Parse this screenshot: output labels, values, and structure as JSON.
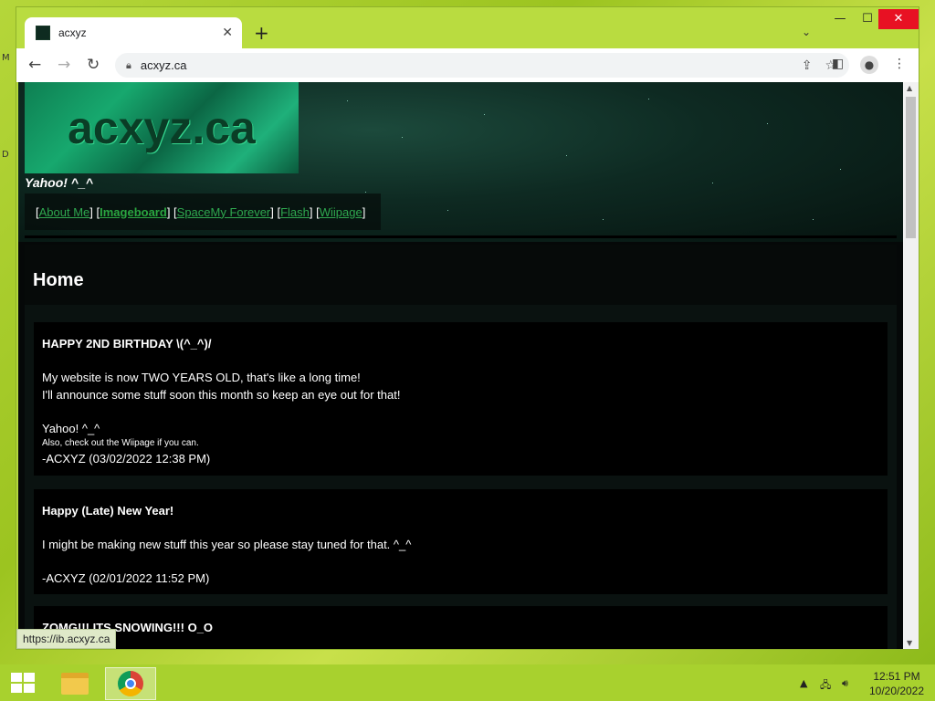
{
  "desktop": {
    "edge_glyphs": [
      "M",
      "D"
    ]
  },
  "browser": {
    "tab": {
      "title": "acxyz",
      "close": "✕"
    },
    "new_tab": "+",
    "tab_list": "⌄",
    "window_controls": {
      "minimize": "—",
      "maximize": "☐",
      "close": "✕"
    },
    "toolbar": {
      "back": "←",
      "forward": "→",
      "reload": "↻",
      "url": "acxyz.ca",
      "side_panel": "◧",
      "menu": "⋮"
    },
    "status_url": "https://ib.acxyz.ca"
  },
  "site": {
    "logo": "acxyz.ca",
    "tagline": "Yahoo! ^_^",
    "nav": [
      {
        "label": "About Me",
        "bold": false
      },
      {
        "label": "Imageboard",
        "bold": true
      },
      {
        "label": "SpaceMy Forever",
        "bold": false
      },
      {
        "label": "Flash",
        "bold": false
      },
      {
        "label": "Wiipage",
        "bold": false
      }
    ],
    "page_title": "Home",
    "posts": [
      {
        "title": "HAPPY 2ND BIRTHDAY \\(^_^)/",
        "lines": [
          "My website is now TWO YEARS OLD, that's like a long time!",
          "I'll announce some stuff soon this month so keep an eye out for that!"
        ],
        "sign_off": "Yahoo! ^_^",
        "note": "Also, check out the Wiipage if you can.",
        "author": "-ACXYZ (03/02/2022 12:38 PM)"
      },
      {
        "title": "Happy (Late) New Year!",
        "lines": [
          "I might be making new stuff this year so please stay tuned for that. ^_^"
        ],
        "author": "-ACXYZ (02/01/2022 11:52 PM)"
      },
      {
        "title": "ZOMG!!! ITS SNOWING!!! O_O"
      }
    ]
  },
  "taskbar": {
    "clock_time": "12:51 PM",
    "clock_date": "10/20/2022"
  },
  "colors": {
    "link": "#2fa84f",
    "page_bg": "#050808",
    "taskbar": "#a8d12e",
    "close_red": "#e81123"
  }
}
